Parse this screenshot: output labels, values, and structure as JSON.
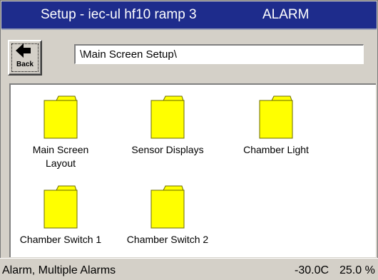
{
  "titlebar": {
    "title": "Setup - iec-ul hf10 ramp 3",
    "status": "ALARM"
  },
  "toolbar": {
    "back_label": "Back",
    "back_icon": "left-arrow-icon",
    "path": "\\Main Screen Setup\\"
  },
  "folders": [
    {
      "label_line1": "Main Screen",
      "label_line2": "Layout",
      "icon": "folder-icon"
    },
    {
      "label_line1": "Sensor Displays",
      "label_line2": "",
      "icon": "folder-icon"
    },
    {
      "label_line1": "Chamber Light",
      "label_line2": "",
      "icon": "folder-icon"
    },
    {
      "label_line1": "Chamber Switch 1",
      "label_line2": "",
      "icon": "folder-icon"
    },
    {
      "label_line1": "Chamber Switch 2",
      "label_line2": "",
      "icon": "folder-icon"
    }
  ],
  "statusbar": {
    "message": "Alarm, Multiple Alarms",
    "temperature": "-30.0C",
    "percent": "25.0 %"
  },
  "colors": {
    "titlebar_bg": "#1e2c8c",
    "folder_fill": "#ffff00",
    "window_bg": "#d4d0c8"
  }
}
